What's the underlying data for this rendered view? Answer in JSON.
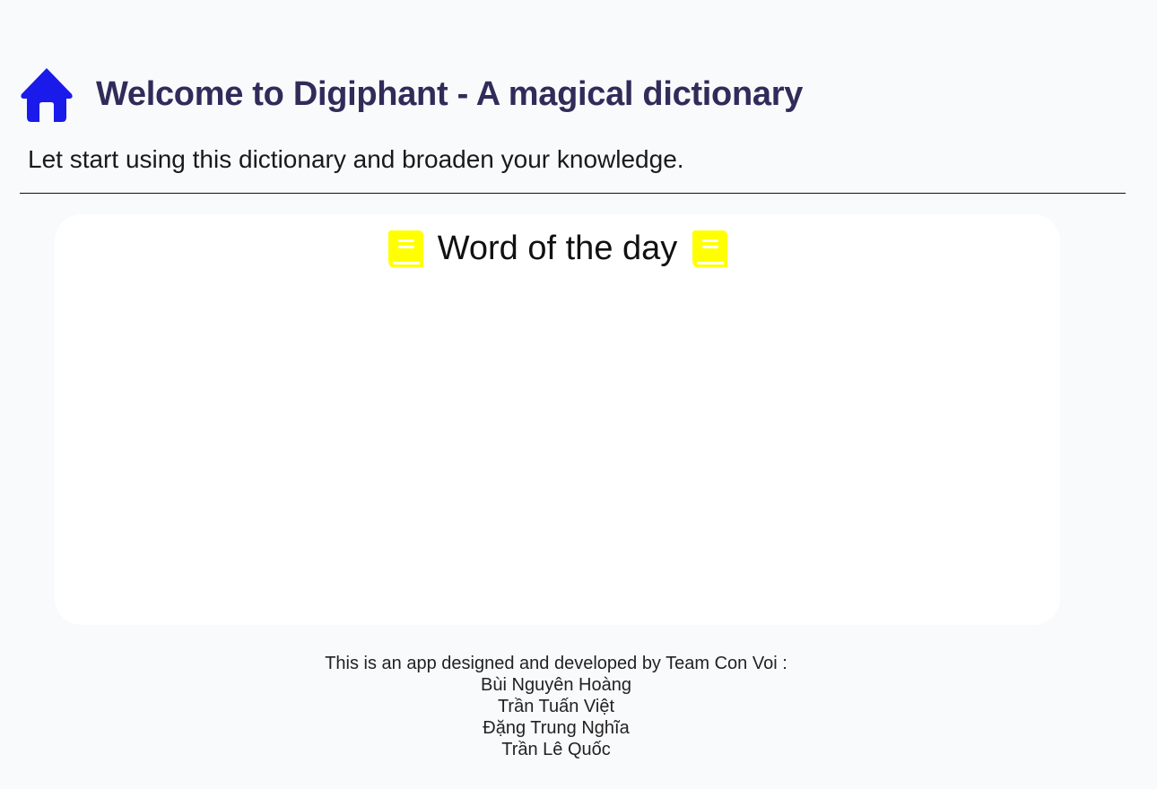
{
  "header": {
    "icon": "home-icon",
    "icon_color": "#1a1aeb",
    "title": "Welcome to Digiphant - A magical dictionary",
    "subtitle": "Let start using this dictionary and broaden your knowledge."
  },
  "word_of_day": {
    "title": "Word of the day",
    "icon": "book-icon",
    "icon_color": "#ffff00"
  },
  "footer": {
    "intro": "This is an app designed and developed by Team Con Voi :",
    "members": [
      "Bùi Nguyên Hoàng",
      "Trần Tuấn Việt",
      "Đặng Trung Nghĩa",
      "Trần Lê Quốc"
    ]
  }
}
